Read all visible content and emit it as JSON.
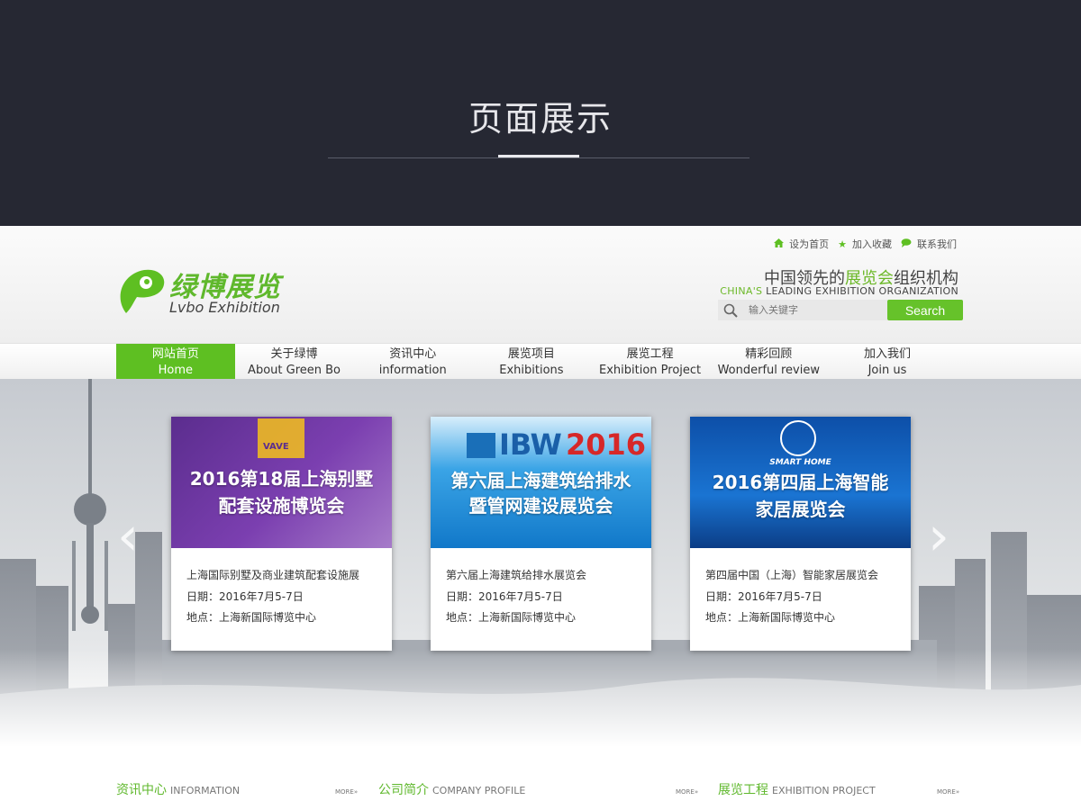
{
  "banner": {
    "title": "页面展示"
  },
  "header": {
    "toplinks": [
      {
        "label": "设为首页",
        "icon": "home-icon"
      },
      {
        "label": "加入收藏",
        "icon": "star-icon"
      },
      {
        "label": "联系我们",
        "icon": "chat-icon"
      }
    ],
    "logo_cn": "绿博展览",
    "logo_en": "Lvbo Exhibition",
    "slogan_cn_pre": "中国领先的",
    "slogan_cn_hl": "展览会",
    "slogan_cn_post": "组织机构",
    "slogan_en_hl": "CHINA'S",
    "slogan_en_post": " LEADING EXHIBITION ORGANIZATION",
    "search_placeholder": "输入关键字",
    "search_button": "Search"
  },
  "nav": [
    {
      "cn": "网站首页",
      "en": "Home"
    },
    {
      "cn": "关于绿博",
      "en": "About Green Bo"
    },
    {
      "cn": "资讯中心",
      "en": "information"
    },
    {
      "cn": "展览项目",
      "en": "Exhibitions"
    },
    {
      "cn": "展览工程",
      "en": "Exhibition Project"
    },
    {
      "cn": "精彩回顾",
      "en": "Wonderful review"
    },
    {
      "cn": "加入我们",
      "en": "Join us"
    }
  ],
  "hero": {
    "cards": [
      {
        "img_badge": "VAVE",
        "img_title_1": "2016第18届上海别墅",
        "img_title_2": "配套设施博览会",
        "name": "上海国际别墅及商业建筑配套设施展",
        "date": "日期：2016年7月5-7日",
        "place": "地点：上海新国际博览中心"
      },
      {
        "img_badge": "IBW",
        "img_year": "2016",
        "img_title_1": "第六届上海建筑给排水",
        "img_title_2": "暨管网建设展览会",
        "name": "第六届上海建筑给排水展览会",
        "date": "日期：2016年7月5-7日",
        "place": "地点：上海新国际博览中心"
      },
      {
        "img_badge": "SMART HOME",
        "img_title_1": "2016第四届上海智能",
        "img_title_2": "家居展览会",
        "name": "第四届中国（上海）智能家居展览会",
        "date": "日期：2016年7月5-7日",
        "place": "地点：上海新国际博览中心"
      }
    ]
  },
  "sections": [
    {
      "cn": "资讯中心",
      "en": "INFORMATION",
      "more": "MORE»"
    },
    {
      "cn": "公司简介",
      "en": "COMPANY PROFILE",
      "more": "MORE»"
    },
    {
      "cn": "展览工程",
      "en": "EXHIBITION PROJECT",
      "more": "MORE»"
    }
  ],
  "colors": {
    "brand_green": "#5ebf22",
    "banner_bg": "#262833"
  }
}
